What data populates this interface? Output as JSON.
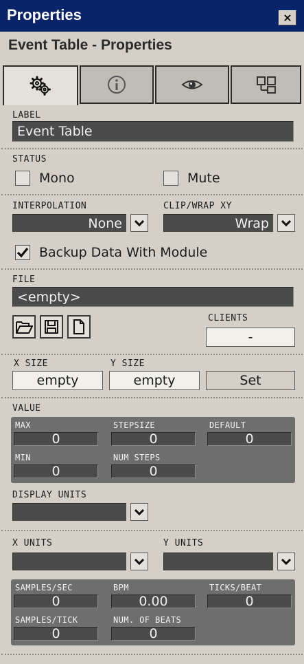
{
  "window": {
    "title": "Properties",
    "close_glyph": "×"
  },
  "subtitle": "Event Table - Properties",
  "tabs": [
    {
      "name": "gears-icon",
      "active": true
    },
    {
      "name": "info-icon",
      "active": false
    },
    {
      "name": "eye-icon",
      "active": false
    },
    {
      "name": "structure-icon",
      "active": false
    }
  ],
  "label_section": {
    "heading": "LABEL",
    "value": "Event Table"
  },
  "status": {
    "heading": "STATUS",
    "mono": "Mono",
    "mute": "Mute"
  },
  "interpolation": {
    "heading": "INTERPOLATION",
    "value": "None"
  },
  "clip_wrap": {
    "heading": "CLIP/WRAP XY",
    "value": "Wrap"
  },
  "backup": {
    "label": "Backup Data With Module",
    "checked": true
  },
  "file": {
    "heading": "FILE",
    "value": "<empty>",
    "clients_heading": "CLIENTS",
    "clients_value": "-"
  },
  "size": {
    "x_heading": "X SIZE",
    "y_heading": "Y SIZE",
    "x_value": "empty",
    "y_value": "empty",
    "set_label": "Set"
  },
  "value": {
    "heading": "VALUE",
    "max_label": "MAX",
    "max": "0",
    "stepsize_label": "STEPSIZE",
    "stepsize": "0",
    "default_label": "DEFAULT",
    "default": "0",
    "min_label": "MIN",
    "min": "0",
    "numsteps_label": "NUM STEPS",
    "numsteps": "0"
  },
  "display_units": {
    "heading": "DISPLAY UNITS",
    "value": ""
  },
  "xy_units": {
    "x_heading": "X UNITS",
    "y_heading": "Y UNITS",
    "x_value": "",
    "y_value": ""
  },
  "timing": {
    "samples_sec_label": "SAMPLES/SEC",
    "samples_sec": "0",
    "bpm_label": "BPM",
    "bpm": "0.00",
    "ticks_beat_label": "TICKS/BEAT",
    "ticks_beat": "0",
    "samples_tick_label": "SAMPLES/TICK",
    "samples_tick": "0",
    "num_beats_label": "NUM. OF BEATS",
    "num_beats": "0"
  },
  "colors": {
    "titlebar": "#0a246a",
    "panel": "#d4d0c8",
    "dark_field": "#4b4b4b",
    "value_panel": "#6e6e6e"
  }
}
